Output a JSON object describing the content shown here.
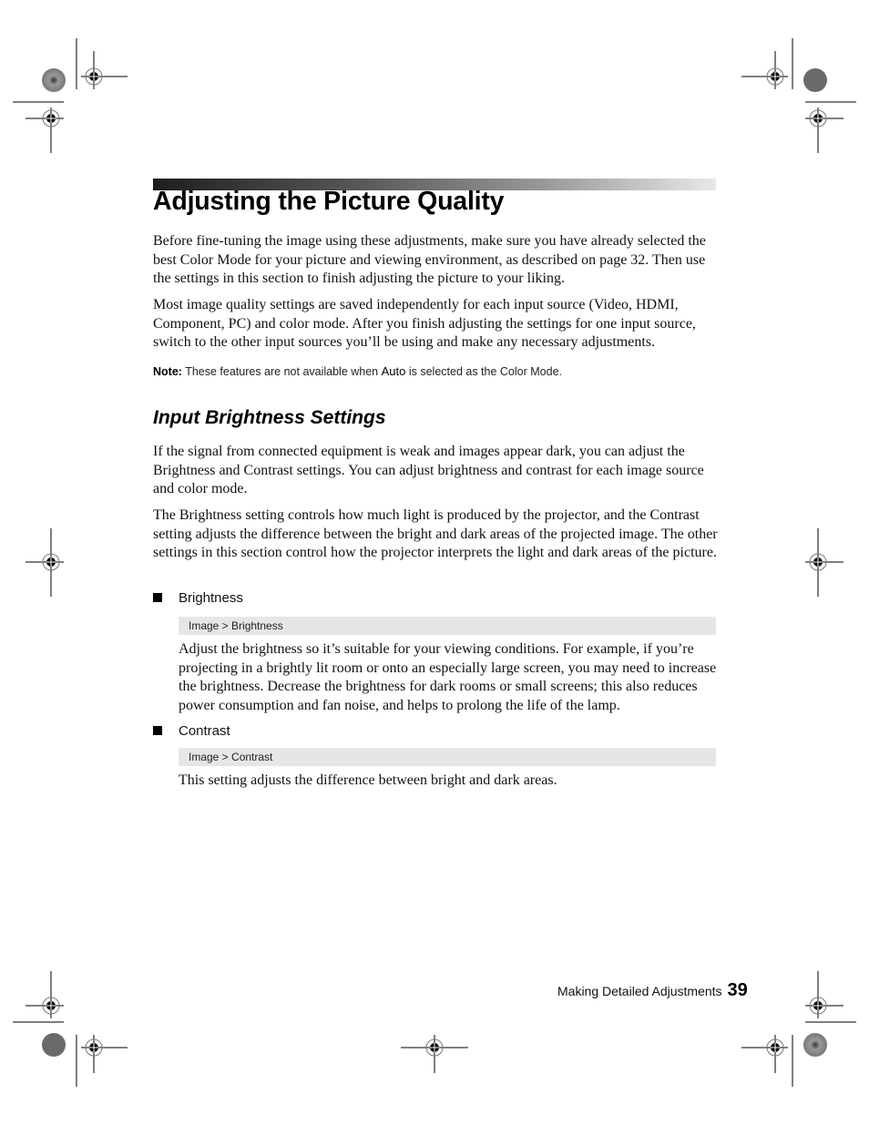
{
  "page": {
    "title": "Adjusting the Picture Quality",
    "intro_paragraphs": [
      "Before fine-tuning the image using these adjustments, make sure you have already selected the best Color Mode for your picture and viewing environment, as described on page 32. Then use the settings in this section to finish adjusting the picture to your liking.",
      "Most image quality settings are saved independently for each input source (Video, HDMI, Component, PC) and color mode. After you finish adjusting the settings for one input source, switch to the other input sources you’ll be using and make any necessary adjustments."
    ],
    "note": {
      "label": "Note:",
      "text_before": " These features are not available when ",
      "keyword": "Auto",
      "text_after": " is selected as the Color Mode."
    },
    "section": {
      "heading": "Input Brightness Settings",
      "paragraphs": [
        "If the signal from connected equipment is weak and images appear dark, you can adjust the Brightness and Contrast settings. You can adjust brightness and contrast for each image source and color mode.",
        "The Brightness setting controls how much light is produced by the projector, and the Contrast setting adjusts the difference between the bright and dark areas of the projected image. The other settings in this section control how the projector interprets the light and dark areas of the picture."
      ],
      "items": [
        {
          "label": "Brightness",
          "menu_path": "Image > Brightness",
          "description": "Adjust the brightness so it’s suitable for your viewing conditions. For example, if you’re projecting in a brightly lit room or onto an especially large screen, you may need to increase the brightness. Decrease the brightness for dark rooms or small screens; this also reduces power consumption and fan noise, and helps to prolong the life of the lamp."
        },
        {
          "label": "Contrast",
          "menu_path": "Image > Contrast",
          "description": "This setting adjusts the difference between bright and dark areas."
        }
      ]
    },
    "footer": {
      "chapter": "Making Detailed Adjustments",
      "page_number": "39"
    }
  },
  "print_marks": {
    "registration_marks": "registration-crosshair-icon",
    "color_targets": "starburst-target-icon"
  }
}
